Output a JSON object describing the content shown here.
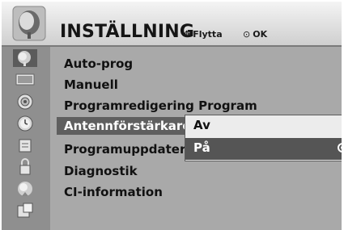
{
  "header": {
    "title": "INSTÄLLNING",
    "hint_move_label": "Flytta",
    "hint_ok_label": "OK",
    "hint_move_icon": "four-way-arrow-icon",
    "hint_ok_icon": "ok-circle-icon",
    "menu_icon": "satellite-dish-icon"
  },
  "sidebar": {
    "icons": [
      "satellite-dish-icon",
      "monitor-icon",
      "speaker-icon",
      "clock-icon",
      "lock-icon",
      "option-icon",
      "input-icon",
      "usb-icon"
    ],
    "selected_index": 0
  },
  "menu": {
    "items": [
      "Auto-prog",
      "Manuell",
      "Programredigering Program",
      "Antennförstärkare",
      "Programuppdatering",
      "Diagnostik",
      "CI-information"
    ],
    "selected_index": 3
  },
  "submenu": {
    "options": [
      "Av",
      "På"
    ],
    "selected_index": 1
  },
  "colors": {
    "header_bg": "#dcdcdc",
    "panel_bg": "#a9a9a9",
    "highlight": "#5f5f5f",
    "submenu_bg": "#ececec"
  }
}
